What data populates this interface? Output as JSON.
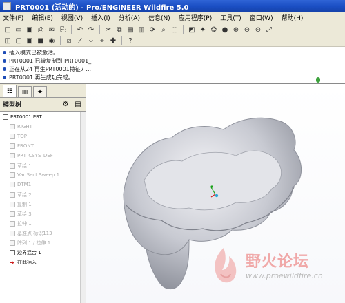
{
  "window": {
    "title": "PRT0001 (活动的) - Pro/ENGINEER Wildfire 5.0"
  },
  "menu": [
    "文件(F)",
    "编辑(E)",
    "视图(V)",
    "插入(I)",
    "分析(A)",
    "信息(N)",
    "应用程序(P)",
    "工具(T)",
    "窗口(W)",
    "帮助(H)"
  ],
  "messages": [
    "插入模式已被激活。",
    "PRT0001 已被复制到 PRT0001_.",
    "正在从24 再生PRT0001特征7 ...",
    "PRT0001 再生成功完成。"
  ],
  "side_tabs": [
    "model-tree",
    "folder-browser",
    "favorites"
  ],
  "tree": {
    "header": "模型树",
    "items": [
      {
        "label": "PRT0001.PRT",
        "active": true
      },
      {
        "label": "RIGHT",
        "active": false
      },
      {
        "label": "TOP",
        "active": false
      },
      {
        "label": "FRONT",
        "active": false
      },
      {
        "label": "PRT_CSYS_DEF",
        "active": false
      },
      {
        "label": "草绘 1",
        "active": false
      },
      {
        "label": "Var Sect Sweep 1",
        "active": false
      },
      {
        "label": "DTM1",
        "active": false
      },
      {
        "label": "草绘 2",
        "active": false
      },
      {
        "label": "复制 1",
        "active": false
      },
      {
        "label": "草绘 3",
        "active": false
      },
      {
        "label": "拉伸 1",
        "active": false
      },
      {
        "label": "基准点 标识113",
        "active": false
      },
      {
        "label": "阵列 1 / 拉伸 1",
        "active": false
      },
      {
        "label": "边界混合 1",
        "active": true
      },
      {
        "label": "在此插入",
        "active": true
      }
    ]
  },
  "watermark": {
    "title": "野火论坛",
    "url": "www.proewildfire.cn"
  }
}
